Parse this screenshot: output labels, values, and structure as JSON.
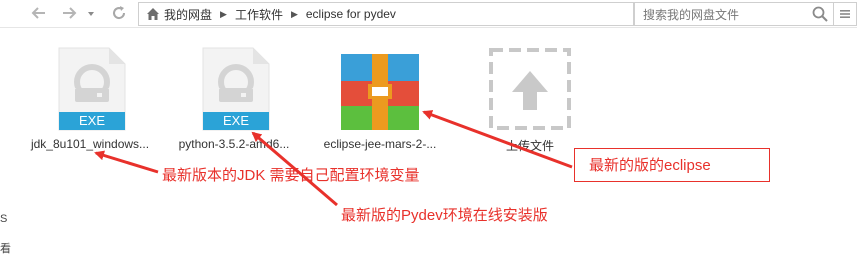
{
  "navigation": {
    "back_icon": "arrow-left-icon",
    "forward_icon": "arrow-right-icon",
    "dropdown_icon": "chevron-down-icon",
    "refresh_icon": "refresh-icon"
  },
  "breadcrumb": {
    "home_icon": "home-icon",
    "items": [
      "我的网盘",
      "工作软件",
      "eclipse for pydev"
    ]
  },
  "search": {
    "placeholder": "搜索我的网盘文件"
  },
  "files": [
    {
      "name": "jdk_8u101_windows...",
      "type_badge": "EXE",
      "icon": "exe-file-icon"
    },
    {
      "name": "python-3.5.2-amd6...",
      "type_badge": "EXE",
      "icon": "exe-file-icon"
    },
    {
      "name": "eclipse-jee-mars-2-...",
      "icon": "archive-file-icon"
    },
    {
      "name": "上传文件",
      "icon": "upload-icon"
    }
  ],
  "annotations": {
    "jdk_note": "最新版本的JDK 需要自己配置环境变量",
    "pydev_note": "最新版的Pydev环境在线安装版",
    "eclipse_note": "最新的版的eclipse",
    "color": "#e8312b"
  },
  "left_edge_glyphs": [
    "S",
    "看"
  ]
}
